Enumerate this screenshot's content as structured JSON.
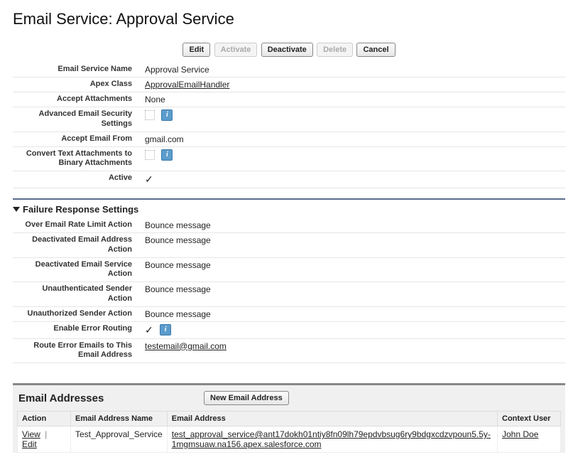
{
  "page": {
    "title_prefix": "Email Service: ",
    "title_name": "Approval Service"
  },
  "buttons": {
    "edit": "Edit",
    "activate": "Activate",
    "deactivate": "Deactivate",
    "delete": "Delete",
    "cancel": "Cancel",
    "new_email_address": "New Email Address"
  },
  "labels": {
    "email_service_name": "Email Service Name",
    "apex_class": "Apex Class",
    "accept_attachments": "Accept Attachments",
    "advanced_email_security": "Advanced Email Security Settings",
    "accept_email_from": "Accept Email From",
    "convert_text_attachments": "Convert Text Attachments to Binary Attachments",
    "active": "Active",
    "failure_response_settings": "Failure Response Settings",
    "over_email_rate_limit": "Over Email Rate Limit Action",
    "deactivated_email_address": "Deactivated Email Address Action",
    "deactivated_email_service": "Deactivated Email Service Action",
    "unauthenticated_sender": "Unauthenticated Sender Action",
    "unauthorized_sender": "Unauthorized Sender Action",
    "enable_error_routing": "Enable Error Routing",
    "route_error_emails": "Route Error Emails to This Email Address",
    "email_addresses": "Email Addresses"
  },
  "values": {
    "email_service_name": "Approval Service",
    "apex_class": "ApprovalEmailHandler",
    "accept_attachments": "None",
    "accept_email_from": "gmail.com",
    "over_email_rate_limit": "Bounce message",
    "deactivated_email_address": "Bounce message",
    "deactivated_email_service": "Bounce message",
    "unauthenticated_sender": "Bounce message",
    "unauthorized_sender": "Bounce message",
    "route_error_emails": "testemail@gmail.com"
  },
  "table": {
    "headers": {
      "action": "Action",
      "email_address_name": "Email Address Name",
      "email_address": "Email Address",
      "context_user": "Context User"
    },
    "row": {
      "view": "View",
      "edit": "Edit",
      "name": "Test_Approval_Service",
      "address": "test_approval_service@ant17dokh01ntiy8fn09lh79epdvbsug6ry9bdgxcdzvpoun5.5y-1mgmsuaw.na156.apex.salesforce.com",
      "context_user": "John Doe"
    }
  }
}
